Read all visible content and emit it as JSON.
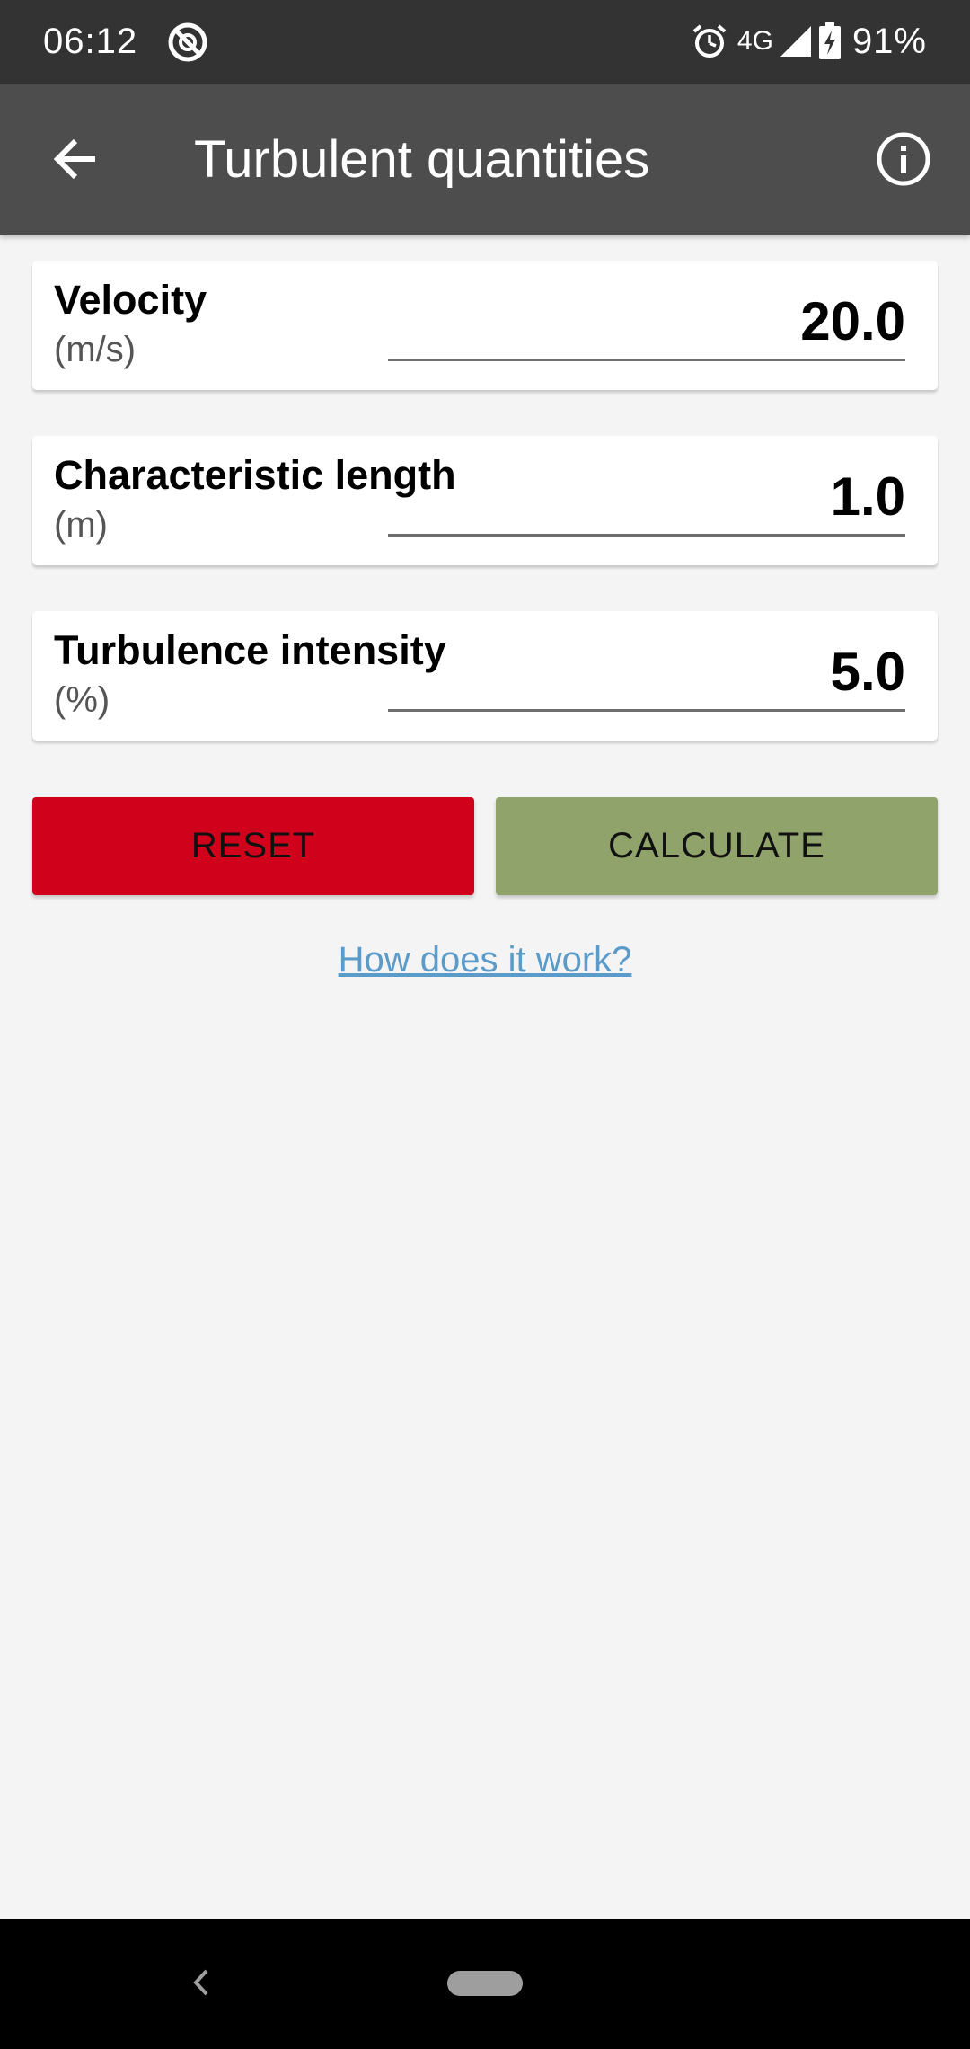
{
  "status_bar": {
    "time": "06:12",
    "network": "4G",
    "battery": "91%",
    "icons": [
      "app-notification-icon",
      "alarm-icon",
      "signal-icon",
      "battery-charging-icon"
    ]
  },
  "app_bar": {
    "title": "Turbulent quantities",
    "icons": [
      "back-arrow-icon",
      "info-icon"
    ]
  },
  "fields": [
    {
      "label": "Velocity",
      "unit": "(m/s)",
      "value": "20.0"
    },
    {
      "label": "Characteristic length",
      "unit": "(m)",
      "value": "1.0"
    },
    {
      "label": "Turbulence intensity",
      "unit": "(%)",
      "value": "5.0"
    }
  ],
  "buttons": {
    "reset": "RESET",
    "calculate": "CALCULATE"
  },
  "help_link": "How does it work?",
  "colors": {
    "status_bar": "#333333",
    "app_bar": "#4d4d4d",
    "background": "#f4f4f4",
    "reset_button": "#d0021b",
    "calculate_button": "#8fa36a",
    "link": "#5b9bc9"
  },
  "nav_bar": {
    "icons": [
      "nav-back-icon",
      "home-pill-icon"
    ]
  }
}
